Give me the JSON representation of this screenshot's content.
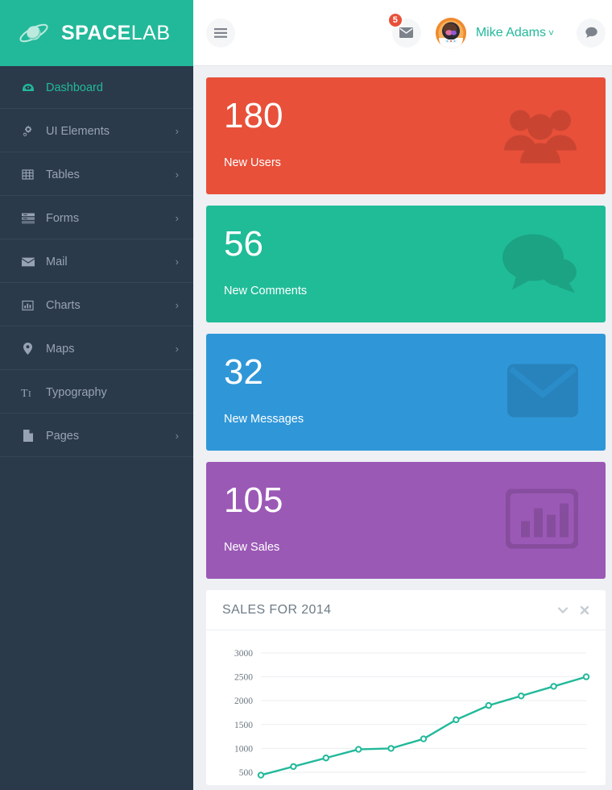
{
  "brand": {
    "name_bold": "SPACE",
    "name_light": "LAB",
    "logo_icon": "planet-icon",
    "bg": "#22b99a"
  },
  "sidebar": {
    "items": [
      {
        "label": "Dashboard",
        "icon": "dashboard-icon",
        "active": true,
        "caret": ""
      },
      {
        "label": "UI Elements",
        "icon": "cogs-icon",
        "active": false,
        "caret": "›"
      },
      {
        "label": "Tables",
        "icon": "table-icon",
        "active": false,
        "caret": "›"
      },
      {
        "label": "Forms",
        "icon": "forms-icon",
        "active": false,
        "caret": "›"
      },
      {
        "label": "Mail",
        "icon": "envelope-icon",
        "active": false,
        "caret": "›"
      },
      {
        "label": "Charts",
        "icon": "bar-chart-icon",
        "active": false,
        "caret": "›"
      },
      {
        "label": "Maps",
        "icon": "map-marker-icon",
        "active": false,
        "caret": "›"
      },
      {
        "label": "Typography",
        "icon": "text-height-icon",
        "active": false,
        "caret": ""
      },
      {
        "label": "Pages",
        "icon": "file-icon",
        "active": false,
        "caret": "›"
      }
    ]
  },
  "topbar": {
    "menu_toggle_icon": "hamburger-icon",
    "mail_icon": "envelope-icon",
    "mail_badge": "5",
    "avatar_icon": "astronaut-avatar",
    "user_name": "Mike Adams",
    "user_caret": "˅",
    "chat_icon": "comment-icon",
    "accent": "#22b99a",
    "badge_color": "#e8503a"
  },
  "stats": [
    {
      "value": "180",
      "label": "New Users",
      "color": "#e8503a",
      "icon": "users-icon"
    },
    {
      "value": "56",
      "label": "New Comments",
      "color": "#20bc98",
      "icon": "comments-icon"
    },
    {
      "value": "32",
      "label": "New Messages",
      "color": "#2f97d8",
      "icon": "envelope-icon"
    },
    {
      "value": "105",
      "label": "New Sales",
      "color": "#9b59b6",
      "icon": "bar-chart-icon"
    }
  ],
  "panel": {
    "title": "SALES FOR 2014",
    "collapse_icon": "chevron-down-icon",
    "close_icon": "close-icon"
  },
  "chart_data": {
    "type": "line",
    "title": "SALES FOR 2014",
    "xlabel": "",
    "ylabel": "",
    "ylim": [
      500,
      3000
    ],
    "yticks": [
      3000,
      2500,
      2000,
      1500,
      1000,
      500
    ],
    "grid": true,
    "legend": "none",
    "line_color": "#22b99a",
    "marker": "open-circle",
    "x": [
      1,
      2,
      3,
      4,
      5,
      6,
      7,
      8,
      9,
      10,
      11
    ],
    "values": [
      440,
      620,
      800,
      980,
      1000,
      1200,
      1600,
      1900,
      2100,
      2300,
      2500
    ]
  }
}
